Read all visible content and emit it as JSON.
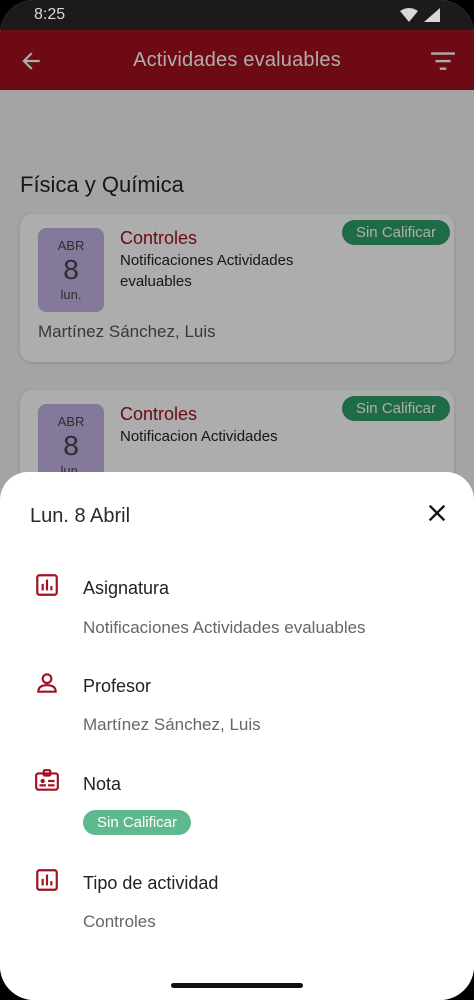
{
  "status_bar": {
    "time": "8:25"
  },
  "app_bar": {
    "title": "Actividades evaluables"
  },
  "section": {
    "title": "Física y Química"
  },
  "cards": [
    {
      "month": "ABR",
      "day": "8",
      "weekday": "lun.",
      "title": "Controles",
      "subtitle": "Notificaciones Actividades evaluables",
      "teacher": "Martínez Sánchez, Luis",
      "status": "Sin Calificar"
    },
    {
      "month": "ABR",
      "day": "8",
      "weekday": "lun.",
      "title": "Controles",
      "subtitle": "Notificacion Actividades",
      "status": "Sin Calificar"
    }
  ],
  "sheet": {
    "date": "Lun. 8 Abril",
    "subject_label": "Asignatura",
    "subject_value": "Notificaciones Actividades evaluables",
    "teacher_label": "Profesor",
    "teacher_value": "Martínez Sánchez, Luis",
    "grade_label": "Nota",
    "grade_value": "Sin Calificar",
    "type_label": "Tipo de actividad",
    "type_value": "Controles"
  },
  "colors": {
    "brand": "#a3101e",
    "badge_green": "#2f9e6b",
    "date_box": "#c3b3e4"
  },
  "icons": {
    "back": "arrow-left-icon",
    "filter": "filter-icon",
    "close": "close-icon",
    "subject": "bar-chart-icon",
    "teacher": "person-icon",
    "grade": "id-card-icon",
    "type": "bar-chart-icon"
  }
}
